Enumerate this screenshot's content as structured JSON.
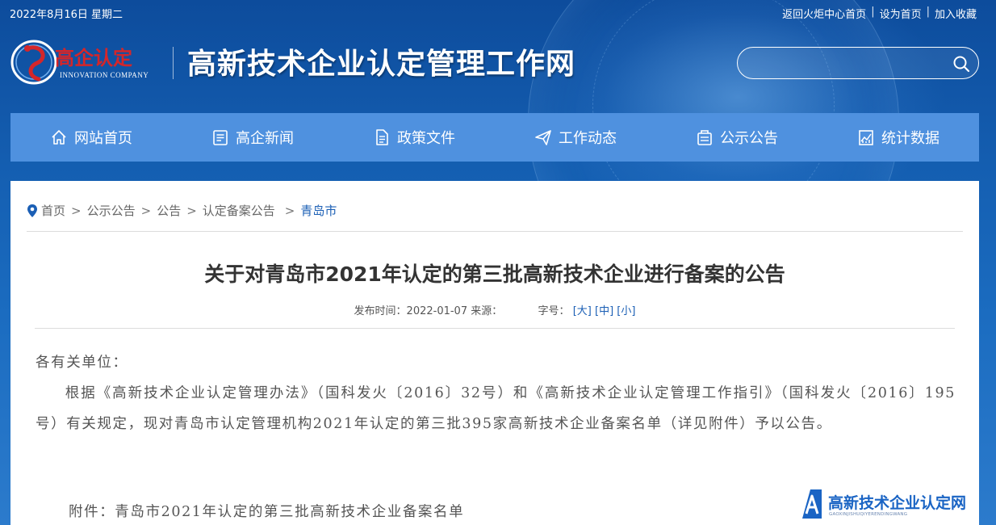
{
  "topbar": {
    "date": "2022年8月16日 星期二",
    "links": [
      "返回火炬中心首页",
      "设为首页",
      "加入收藏"
    ],
    "separator": "|"
  },
  "logo": {
    "cn": "高企认定",
    "en": "INNOVATION COMPANY",
    "site_title": "高新技术企业认定管理工作网"
  },
  "search": {
    "placeholder": "",
    "icon": "search-icon"
  },
  "nav": [
    {
      "label": "网站首页",
      "icon": "home-icon"
    },
    {
      "label": "高企新闻",
      "icon": "news-icon"
    },
    {
      "label": "政策文件",
      "icon": "document-icon"
    },
    {
      "label": "工作动态",
      "icon": "paper-plane-icon"
    },
    {
      "label": "公示公告",
      "icon": "announcement-icon"
    },
    {
      "label": "统计数据",
      "icon": "chart-icon"
    }
  ],
  "breadcrumb": {
    "items": [
      "首页",
      "公示公告",
      "公告",
      "认定备案公告"
    ],
    "current": "青岛市",
    "separator": ">"
  },
  "article": {
    "title": "关于对青岛市2021年认定的第三批高新技术企业进行备案的公告",
    "publish_label": "发布时间：",
    "publish_date": "2022-01-07",
    "source_label": "来源：",
    "source_value": "",
    "font_size_label": "字号：",
    "font_sizes": [
      "[大]",
      "[中]",
      "[小]"
    ],
    "salutation": "各有关单位：",
    "paragraph": "根据《高新技术企业认定管理办法》（国科发火〔2016〕32号）和《高新技术企业认定管理工作指引》（国科发火〔2016〕195号）有关规定，现对青岛市认定管理机构2021年认定的第三批395家高新技术企业备案名单（详见附件）予以公告。",
    "attachment": "附件：青岛市2021年认定的第三批高新技术企业备案名单"
  },
  "watermark": {
    "title": "高新技术企业认定网",
    "subtitle": "GAOXINJISHUQIYERENDINGWANG"
  },
  "colors": {
    "header_blue": "#1560b3",
    "nav_blue": "#4f91df",
    "link_blue": "#1b5fb5",
    "logo_red": "#d4262a"
  }
}
